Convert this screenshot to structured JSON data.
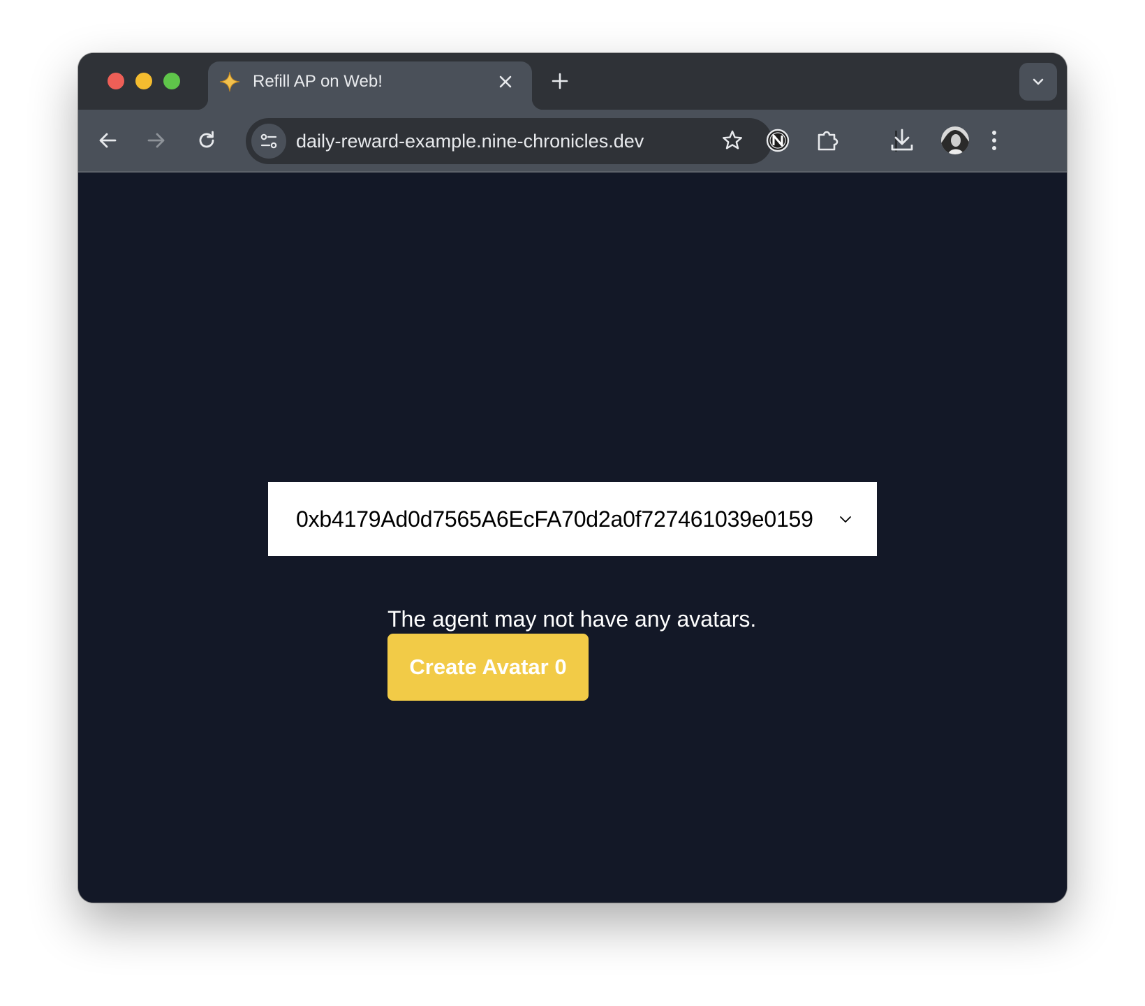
{
  "browser": {
    "tab": {
      "title": "Refill AP on Web!",
      "favicon": "sparkle-icon"
    },
    "url": "daily-reward-example.nine-chronicles.dev",
    "toolbar_icons": [
      "back-icon",
      "forward-icon",
      "reload-icon",
      "site-info-icon",
      "bookmark-star-icon",
      "nine-chronicles-extension-icon",
      "extensions-puzzle-icon",
      "download-icon",
      "profile-avatar",
      "more-menu-icon"
    ],
    "colors": {
      "tabbar": "#2f3237",
      "toolbar": "#4a5059"
    }
  },
  "page": {
    "agent_select": {
      "value": "0xb4179Ad0d7565A6EcFA70d2a0f727461039e0159"
    },
    "message": "The agent may not have any avatars.",
    "create_button_label": "Create Avatar 0",
    "colors": {
      "background": "#131827",
      "button": "#f2cb47"
    }
  }
}
